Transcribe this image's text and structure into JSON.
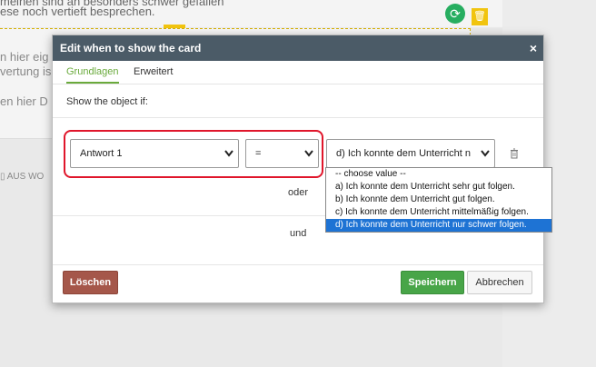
{
  "background": {
    "line1": "meinen sind an besonders schwer gefallen",
    "line2": "ese noch vertieft besprechen.",
    "text1": "n hier eig",
    "text2": "vertung is",
    "text3": "en hier D",
    "aus_label": "AUS WO",
    "accent_green": "#27ae60",
    "accent_yellow": "#f1c40f"
  },
  "modal": {
    "title": "Edit when to show the card",
    "close_glyph": "×",
    "tabs": [
      {
        "label": "Grundlagen",
        "active": true
      },
      {
        "label": "Erweitert",
        "active": false
      }
    ],
    "subtitle": "Show the object if:",
    "condition": {
      "field_value": "Antwort 1",
      "operator_value": "=",
      "value_value": "d) Ich konnte dem Unterricht n"
    },
    "or_label": "oder",
    "and_label": "und",
    "buttons": {
      "delete": "Löschen",
      "save": "Speichern",
      "cancel": "Abbrechen"
    },
    "colors": {
      "header_bg": "#4b5b67",
      "tab_active": "#6aaa3c",
      "highlight_border": "#e0162b",
      "delete_bg": "#a5574a",
      "save_bg": "#48a548",
      "selected_option": "#1e73d4"
    }
  },
  "dropdown": {
    "options": [
      "-- choose value --",
      "a) Ich konnte dem Unterricht sehr gut folgen.",
      "b) Ich konnte dem Unterricht gut folgen.",
      "c) Ich konnte dem Unterricht mittelmäßig folgen.",
      "d) Ich konnte dem Unterricht nur schwer folgen."
    ],
    "selected_index": 4
  }
}
